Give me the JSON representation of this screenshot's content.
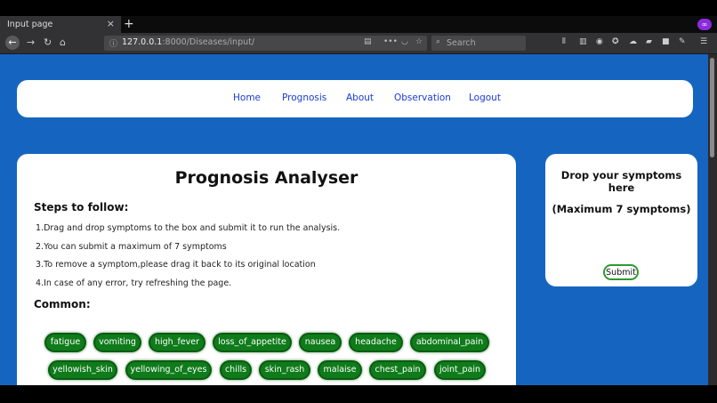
{
  "browser": {
    "tab_title": "Input page",
    "tab_close": "×",
    "new_tab": "+",
    "url_host": "127.0.0.1",
    "url_path": ":8000/Diseases/input/",
    "search_placeholder": "Search",
    "private_badge": "∞"
  },
  "nav": {
    "links": [
      "Home",
      "Prognosis",
      "About",
      "Observation",
      "Logout"
    ]
  },
  "main": {
    "title": "Prognosis Analyser",
    "steps_heading": "Steps to follow:",
    "steps": [
      "1.Drag and drop symptoms to the box and submit it to run the analysis.",
      "2.You can submit a maximum of 7 symptoms",
      "3.To remove a symptom,please drag it back to its original location",
      "4.In case of any error, try refreshing the page."
    ],
    "common_heading": "Common:",
    "symptoms_row1": [
      "fatigue",
      "vomiting",
      "high_fever",
      "loss_of_appetite",
      "nausea",
      "headache",
      "abdominal_pain"
    ],
    "symptoms_row2": [
      "yellowish_skin",
      "yellowing_of_eyes",
      "chills",
      "skin_rash",
      "malaise",
      "chest_pain",
      "joint_pain"
    ]
  },
  "dropbox": {
    "title_line1": "Drop your symptoms",
    "title_line2": "here",
    "limit_text": "(Maximum 7 symptoms)",
    "submit_label": "Submit"
  },
  "colors": {
    "page_background": "#1565c0",
    "chip_green": "#0f7b1a",
    "link_blue": "#1a3ad6"
  }
}
